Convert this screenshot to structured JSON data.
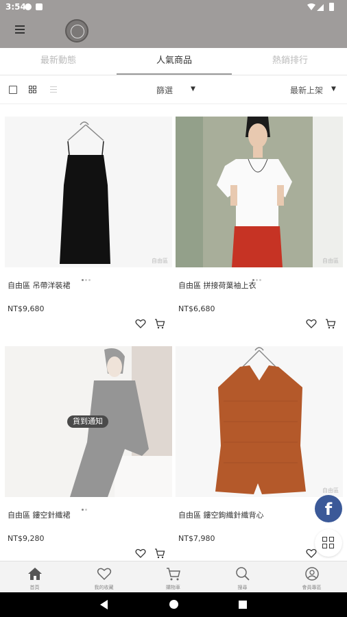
{
  "status_bar": {
    "time": "3:54"
  },
  "tabs": [
    {
      "label": "最新動態",
      "active": false
    },
    {
      "label": "人氣商品",
      "active": true
    },
    {
      "label": "熱銷排行",
      "active": false
    }
  ],
  "toolbar": {
    "filter_label": "篩選",
    "sort_label": "最新上架"
  },
  "products": [
    {
      "name": "自由區 吊帶洋裝裙",
      "price": "NT$9,680",
      "watermark": "自由區"
    },
    {
      "name": "自由區 拼接荷葉袖上衣",
      "price": "NT$6,680",
      "watermark": "自由區"
    },
    {
      "name": "自由區 鏤空針織裙",
      "price": "NT$9,280",
      "badge": "貨到通知"
    },
    {
      "name": "自由區 鏤空鉤織針織背心",
      "price": "NT$7,980",
      "watermark": "自由區"
    }
  ],
  "floating": {
    "facebook_label": "f"
  },
  "bottom_nav": [
    {
      "label": "首頁",
      "icon": "home-icon"
    },
    {
      "label": "我的收藏",
      "icon": "heart-icon"
    },
    {
      "label": "購物車",
      "icon": "cart-icon"
    },
    {
      "label": "搜尋",
      "icon": "search-icon"
    },
    {
      "label": "會員專區",
      "icon": "user-icon"
    }
  ],
  "colors": {
    "header_bg": "#9f9c9b",
    "facebook": "#3b5998",
    "text": "#333333"
  }
}
